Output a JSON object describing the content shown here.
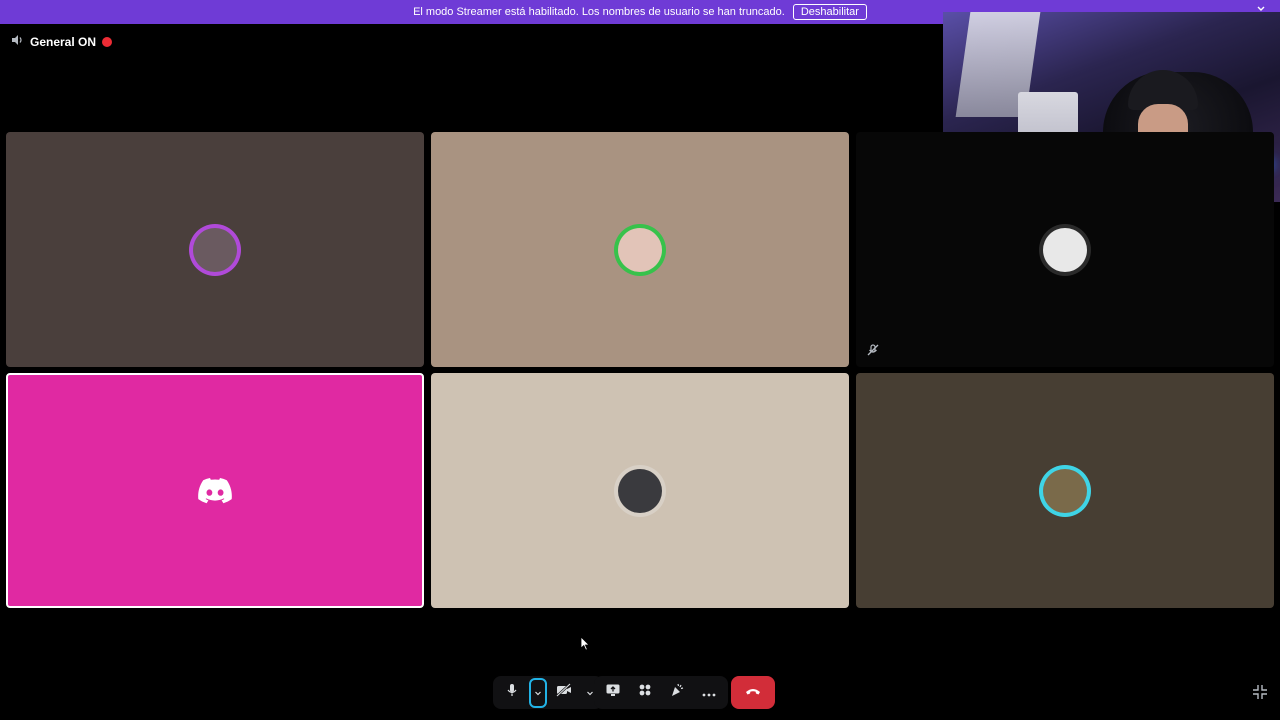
{
  "colors": {
    "banner_bg": "#6f3bd6",
    "live_dot": "#ed2c35",
    "hangup": "#d22d39",
    "focus_ring": "#22b3e6",
    "discord_blurple": "#ffffff"
  },
  "banner": {
    "message": "El modo Streamer está habilitado. Los nombres de usuario se han truncado.",
    "button_label": "Deshabilitar"
  },
  "channel": {
    "icon": "speaker-icon",
    "name": "General ON"
  },
  "tiles": [
    {
      "bg": "#4a3f3c",
      "avatar_ring": "#b04ad9",
      "avatar_fill": "#6a5a60",
      "muted": false,
      "speaking": false
    },
    {
      "bg": "#a99381",
      "avatar_ring": "#37c24b",
      "avatar_fill": "#e2c4b8",
      "muted": false,
      "speaking": false
    },
    {
      "bg": "#070707",
      "avatar_ring": "#2a2a2a",
      "avatar_fill": "#e8e8e8",
      "muted": true,
      "speaking": false
    },
    {
      "bg": "#e029a2",
      "avatar_ring": "",
      "avatar_fill": "",
      "muted": false,
      "speaking": true,
      "discord_default": true
    },
    {
      "bg": "#cec2b3",
      "avatar_ring": "#d8d0c6",
      "avatar_fill": "#3a3a3e",
      "muted": false,
      "speaking": false
    },
    {
      "bg": "#473e33",
      "avatar_ring": "#3fd4e6",
      "avatar_fill": "#7a6a4a",
      "muted": false,
      "speaking": false
    }
  ],
  "controls": {
    "mic": "microphone-icon",
    "mic_options": "chevron-down-icon",
    "camera": "camera-off-icon",
    "camera_options": "chevron-down-icon",
    "screen_share": "screen-share-icon",
    "activities": "activities-icon",
    "soundboard": "soundboard-icon",
    "more": "more-icon",
    "disconnect": "phone-hangup-icon",
    "fullscreen": "exit-fullscreen-icon"
  }
}
